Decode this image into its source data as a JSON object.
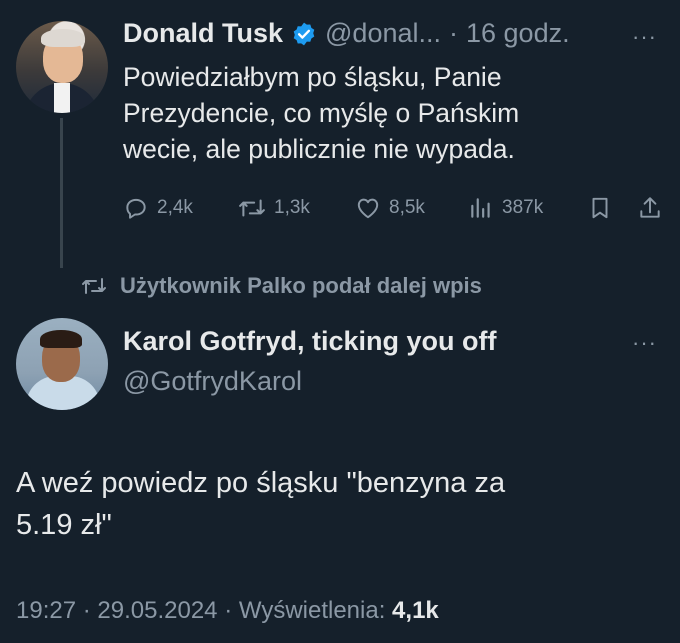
{
  "tweet1": {
    "name": "Donald Tusk",
    "handle": "@donal...",
    "separator": "·",
    "time": "16 godz.",
    "text_line1": "Powiedziałbym po śląsku, Panie",
    "text_line2": "Prezydencie, co myślę o Pańskim",
    "text_line3": "wecie, ale publicznie nie wypada.",
    "reply_count": "2,4k",
    "repost_count": "1,3k",
    "like_count": "8,5k",
    "view_count": "387k"
  },
  "repost_notice": "Użytkownik Palko podał dalej wpis",
  "tweet2": {
    "name": "Karol Gotfryd, ticking you off",
    "handle": "@GotfrydKarol",
    "text_line1": "A weź powiedz po śląsku \"benzyna za",
    "text_line2": "5.19 zł\"",
    "time": "19:27",
    "date": "29.05.2024",
    "views_label": "Wyświetlenia:",
    "views_value": "4,1k",
    "sep": "·"
  },
  "more_glyph": "···",
  "colors": {
    "background": "#15202b",
    "text": "#e7e9ea",
    "muted": "#8b98a5",
    "verified": "#1d9bf0"
  },
  "icons": [
    "verified-badge-icon",
    "reply-icon",
    "repost-icon",
    "like-icon",
    "views-icon",
    "bookmark-icon",
    "share-icon",
    "more-icon"
  ]
}
